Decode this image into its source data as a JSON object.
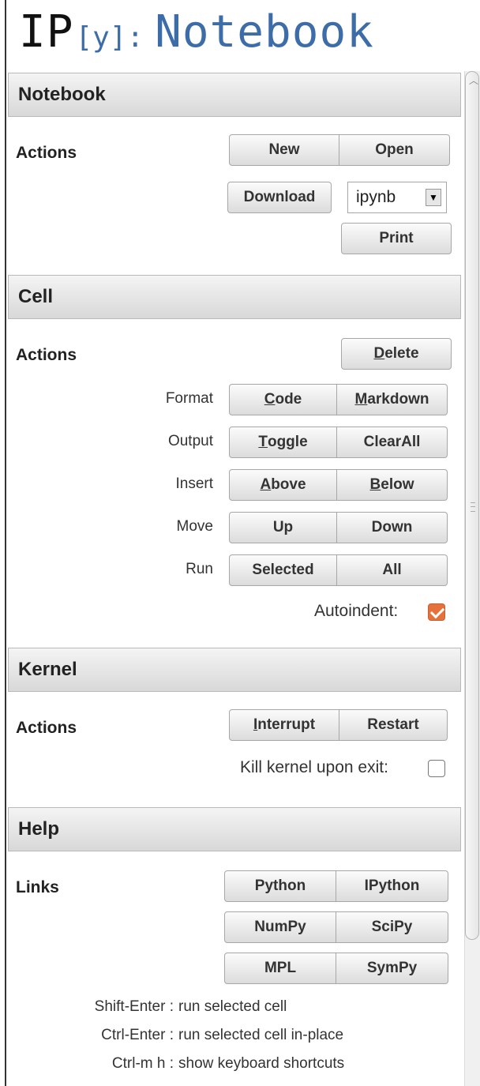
{
  "header": {
    "logo_ip": "IP",
    "logo_y": "[y]",
    "logo_colon": ":",
    "title": "Notebook"
  },
  "notebook": {
    "title": "Notebook",
    "actions_label": "Actions",
    "new_label": "New",
    "open_label": "Open",
    "download_label": "Download",
    "format_select": {
      "value": "ipynb"
    },
    "print_label": "Print"
  },
  "cell": {
    "title": "Cell",
    "actions_label": "Actions",
    "delete_label": "Delete",
    "format_label": "Format",
    "code_label": "Code",
    "markdown_label": "Markdown",
    "output_label": "Output",
    "toggle_label": "Toggle",
    "clearall_label": "ClearAll",
    "insert_label": "Insert",
    "above_label": "Above",
    "below_label": "Below",
    "move_label": "Move",
    "up_label": "Up",
    "down_label": "Down",
    "run_label": "Run",
    "selected_label": "Selected",
    "all_label": "All",
    "autoindent_label": "Autoindent:",
    "autoindent_checked": true
  },
  "kernel": {
    "title": "Kernel",
    "actions_label": "Actions",
    "interrupt_label": "Interrupt",
    "restart_label": "Restart",
    "kill_label": "Kill kernel upon exit:",
    "kill_checked": false
  },
  "help": {
    "title": "Help",
    "links_label": "Links",
    "python_label": "Python",
    "ipython_label": "IPython",
    "numpy_label": "NumPy",
    "scipy_label": "SciPy",
    "mpl_label": "MPL",
    "sympy_label": "SymPy",
    "shortcuts": [
      {
        "key": "Shift-Enter :",
        "desc": "run selected cell"
      },
      {
        "key": "Ctrl-Enter :",
        "desc": "run selected cell in-place"
      },
      {
        "key": "Ctrl-m h :",
        "desc": "show keyboard shortcuts"
      }
    ]
  },
  "colors": {
    "accent": "#3d6da8",
    "checkbox_checked": "#e5723a"
  }
}
